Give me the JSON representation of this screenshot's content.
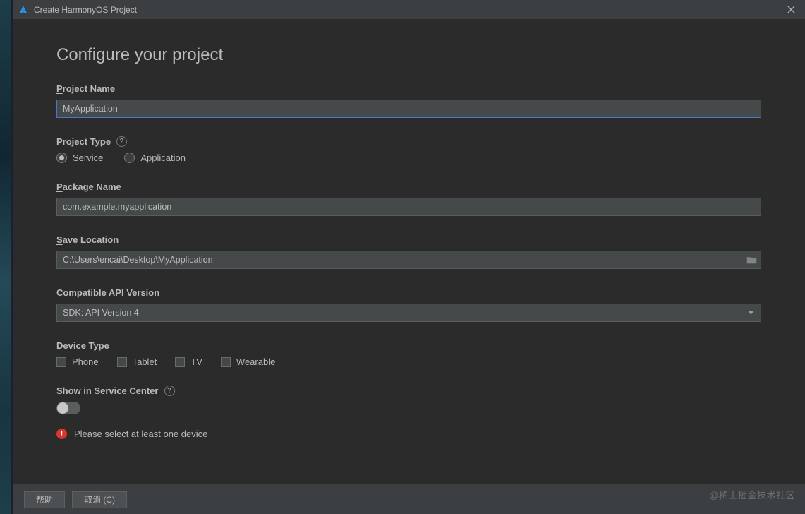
{
  "window": {
    "title": "Create HarmonyOS Project"
  },
  "page": {
    "heading": "Configure your project",
    "project_name": {
      "label": "Project Name",
      "value": "MyApplication"
    },
    "project_type": {
      "label": "Project Type",
      "options": {
        "service": "Service",
        "application": "Application"
      },
      "selected": "service"
    },
    "package_name": {
      "label": "Package Name",
      "value": "com.example.myapplication"
    },
    "save_location": {
      "label": "Save Location",
      "value": "C:\\Users\\encai\\Desktop\\MyApplication"
    },
    "api_version": {
      "label": "Compatible API Version",
      "value": "SDK: API Version 4"
    },
    "device_type": {
      "label": "Device Type",
      "options": {
        "phone": "Phone",
        "tablet": "Tablet",
        "tv": "TV",
        "wearable": "Wearable"
      }
    },
    "service_center": {
      "label": "Show in Service Center",
      "value": false
    },
    "error": "Please select at least one device"
  },
  "footer": {
    "help": "帮助",
    "cancel": "取消 (C)"
  },
  "watermark": "@稀土掘金技术社区"
}
